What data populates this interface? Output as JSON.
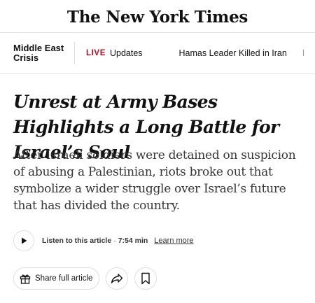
{
  "masthead": {
    "logo_text": "The New York Times"
  },
  "topic_bar": {
    "section_label": "Middle East Crisis",
    "live_badge": "LIVE",
    "live_link": "Updates",
    "link_2": "Hamas Leader Killed in Iran",
    "link_3_partial": "I"
  },
  "article": {
    "headline": "Unrest at Army Bases Highlights a Long Battle for Israel’s Soul",
    "summary": "After Israeli soldiers were detained on suspicion of abusing a Palestinian, riots broke out that symbolize a wider struggle over Israel’s future that has divided the country."
  },
  "audio": {
    "listen_label": "Listen to this article",
    "separator": "·",
    "duration": "7:54 min",
    "learn_more": "Learn more",
    "play_icon": "play-icon"
  },
  "actions": {
    "share_full_article": "Share full article",
    "gift_icon": "gift-icon",
    "share_icon": "share-arrow-icon",
    "save_icon": "bookmark-icon"
  },
  "colors": {
    "live_red": "#d0021b",
    "text": "#121212",
    "summary_text": "#363636",
    "border": "#dfdfdf"
  }
}
